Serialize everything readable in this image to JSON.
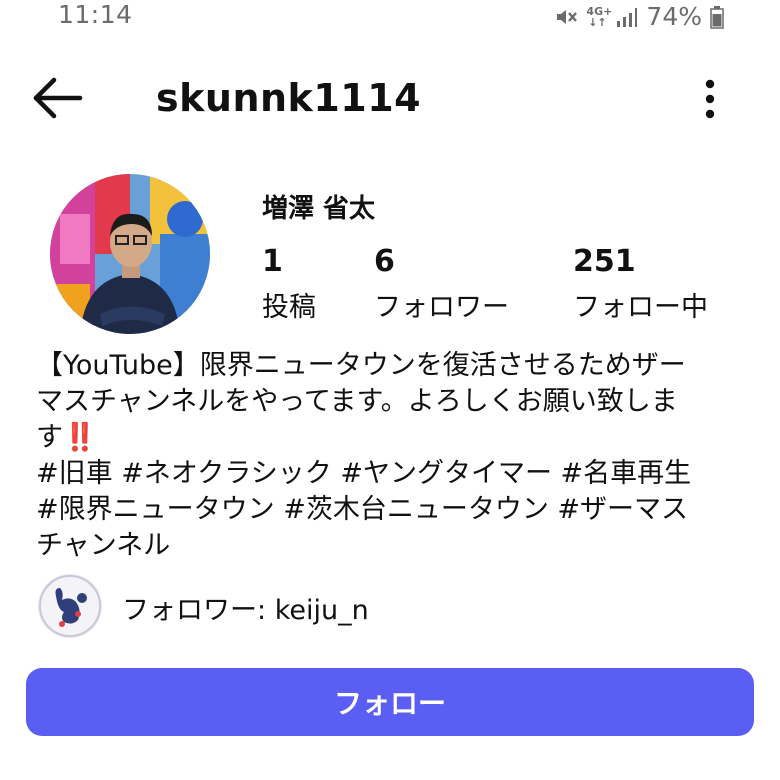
{
  "status_bar": {
    "time": "11:14",
    "network_top": "4G+",
    "network_bottom": "↓↑",
    "battery": "74%",
    "icons": [
      "mute-icon",
      "signal-icon",
      "battery-icon"
    ]
  },
  "header": {
    "username": "skunnk1114",
    "back_icon": "arrow-left-icon",
    "more_icon": "more-vertical-icon"
  },
  "profile": {
    "display_name": "増澤 省太",
    "stats": [
      {
        "count": "1",
        "label": "投稿"
      },
      {
        "count": "6",
        "label": "フォロワー"
      },
      {
        "count": "251",
        "label": "フォロー中"
      }
    ],
    "bio": {
      "line1": "【YouTube】限界ニュータウンを復活させるためザー",
      "line2": "マスチャンネルをやってます。よろしくお願い致しま",
      "line3_text": "す",
      "line3_emoji": "‼️",
      "line4": "#旧車 #ネオクラシック #ヤングタイマー #名車再生",
      "line5": "#限界ニュータウン #茨木台ニュータウン #ザーマス",
      "line6": "チャンネル"
    },
    "followed_by_label": "フォロワー: ",
    "followed_by_user": "keiju_n"
  },
  "actions": {
    "follow_label": "フォロー"
  },
  "colors": {
    "accent": "#5b5ef2",
    "status_text": "#6b6b6b",
    "emoji_red": "#e0232f"
  }
}
